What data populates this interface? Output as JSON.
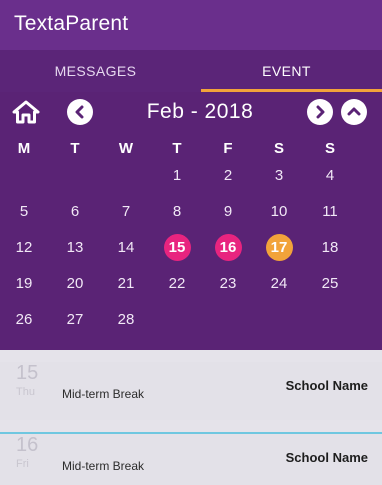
{
  "app": {
    "title": "TextaParent"
  },
  "tabs": [
    {
      "label": "MESSAGES",
      "active": false
    },
    {
      "label": "EVENT",
      "active": true
    }
  ],
  "calendar": {
    "month_label": "Feb - 2018",
    "weekdays": [
      "M",
      "T",
      "W",
      "T",
      "F",
      "S",
      "S"
    ],
    "weeks": [
      [
        "",
        "",
        "",
        "1",
        "2",
        "3",
        "4"
      ],
      [
        "5",
        "6",
        "7",
        "8",
        "9",
        "10",
        "11"
      ],
      [
        "12",
        "13",
        "14",
        "15",
        "16",
        "17",
        "18"
      ],
      [
        "19",
        "20",
        "21",
        "22",
        "23",
        "24",
        "25"
      ],
      [
        "26",
        "27",
        "28",
        "",
        "",
        "",
        ""
      ]
    ],
    "highlights": {
      "15": "#e8247f",
      "16": "#e8247f",
      "17": "#f2a33a"
    }
  },
  "events": [
    {
      "date": "15",
      "day": "Thu",
      "title": "Mid-term Break",
      "school": "School Name"
    },
    {
      "date": "16",
      "day": "Fri",
      "title": "Mid-term Break",
      "school": "School Name"
    }
  ],
  "colors": {
    "header": "#6a2f8c",
    "tabs": "#5b2578",
    "calendar": "#5a2375",
    "tab_indicator": "#f2a33a",
    "separator": "#6fc7e0"
  },
  "icons": {
    "home": "home-icon",
    "prev": "chevron-left-icon",
    "next": "chevron-right-icon",
    "collapse": "chevron-up-icon"
  }
}
